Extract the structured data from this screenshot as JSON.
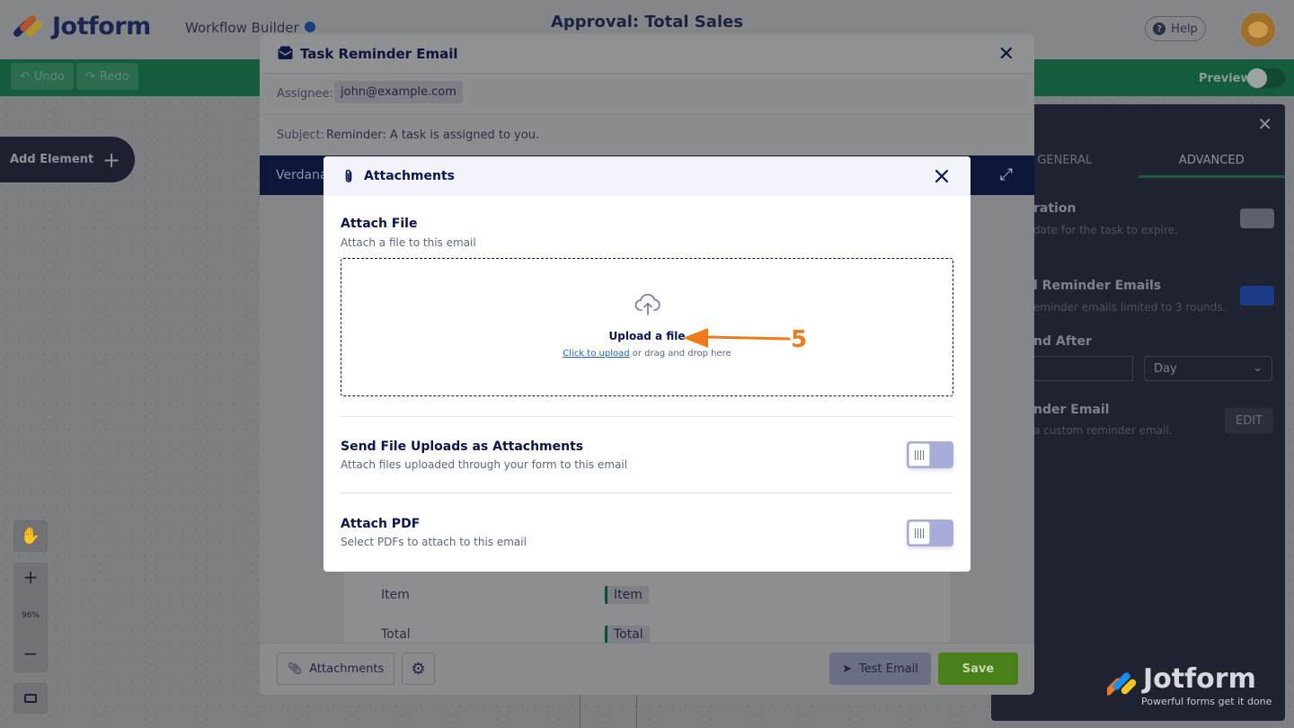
{
  "app": {
    "logo_text": "Jotform",
    "workflow_label": "Workflow Builder",
    "title": "Approval: Total Sales",
    "help_label": "Help"
  },
  "toolbar": {
    "undo_label": "Undo",
    "redo_label": "Redo",
    "preview_label": "Preview"
  },
  "canvas": {
    "add_element_label": "Add Element",
    "zoom_level": "96%"
  },
  "right_panel": {
    "tabs": [
      "GENERAL",
      "ADVANCED"
    ],
    "active_tab": "ADVANCED",
    "rows": [
      {
        "title": "ration",
        "desc": "date for the task to expire."
      },
      {
        "title": "l Reminder Emails",
        "desc": "eminder emails limited to 3 rounds."
      },
      {
        "title": "nd After",
        "desc": ""
      },
      {
        "title": "nder Email",
        "desc": "a custom reminder email."
      }
    ],
    "resend_unit": "Day",
    "edit_label": "EDIT"
  },
  "email_editor": {
    "title": "Task Reminder Email",
    "assignee_label": "Assignee:",
    "assignee_value": "john@example.com",
    "subject_label": "Subject:",
    "subject_value": "Reminder: A task is assigned to you.",
    "font_name": "Verdana",
    "table_rows": [
      {
        "label": "Item",
        "tag": "Item"
      },
      {
        "label": "Total",
        "tag": "Total"
      }
    ],
    "attachments_label": "Attachments",
    "test_email_label": "Test Email",
    "save_label": "Save"
  },
  "attachments_dialog": {
    "title": "Attachments",
    "attach_file": {
      "title": "Attach File",
      "desc": "Attach a file to this email",
      "upload_title": "Upload a file",
      "click_to_upload": "Click to upload",
      "drag_text": " or drag and drop here"
    },
    "send_uploads": {
      "title": "Send File Uploads as Attachments",
      "desc": "Attach files uploaded through your form to this email",
      "enabled": false
    },
    "attach_pdf": {
      "title": "Attach PDF",
      "desc": "Select PDFs to attach to this email",
      "enabled": false
    }
  },
  "annotation": {
    "step_number": "5"
  },
  "watermark": {
    "name": "Jotform",
    "tagline": "Powerful forms get it done"
  },
  "colors": {
    "navy": "#0a1551",
    "accent_orange": "#f07a1a",
    "link_blue": "#1d62c7",
    "save_green": "#4a7f1a",
    "toggle_off": "#a8acd8"
  }
}
